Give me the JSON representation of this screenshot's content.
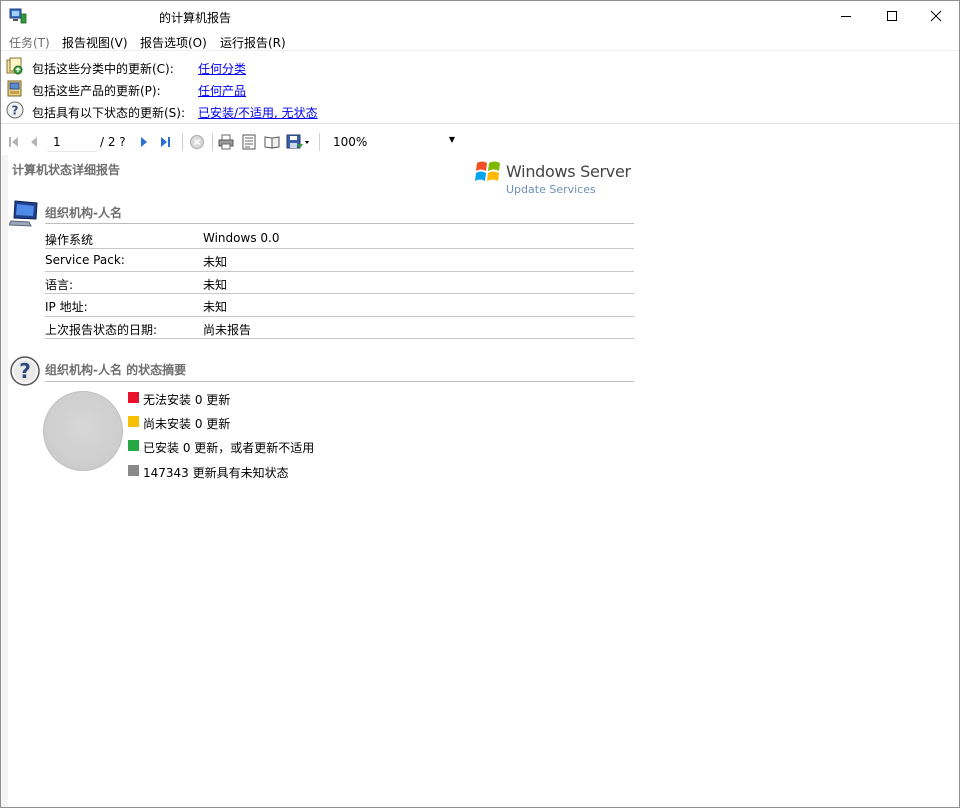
{
  "window": {
    "title": "的计算机报告"
  },
  "menu": [
    "任务(T)",
    "报告视图(V)",
    "报告选项(O)",
    "运行报告(R)"
  ],
  "criteria": [
    {
      "label": "包括这些分类中的更新(C):",
      "link": "任何分类",
      "icon": "classification-icon"
    },
    {
      "label": "包括这些产品的更新(P):",
      "link": "任何产品",
      "icon": "product-icon"
    },
    {
      "label": "包括具有以下状态的更新(S):",
      "link": "已安装/不适用, 无状态",
      "icon": "status-question-icon"
    }
  ],
  "toolbar": {
    "page_current": "1",
    "page_total": "/ 2 ?",
    "zoom": "100%"
  },
  "report": {
    "title": "计算机状态详细报告",
    "logo_name": "Windows Server",
    "logo_sub": "Update Services",
    "section1_title": "组织机构-人名",
    "info": [
      {
        "key": "操作系统",
        "value": "Windows 0.0"
      },
      {
        "key": "Service Pack:",
        "value": "未知"
      },
      {
        "key": "语言:",
        "value": "未知"
      },
      {
        "key": "IP 地址:",
        "value": "未知"
      },
      {
        "key": "上次报告状态的日期:",
        "value": "尚未报告"
      }
    ],
    "section2_title": "组织机构-人名 的状态摘要",
    "legend": [
      {
        "label": "无法安装 0 更新",
        "color": "#e8102a"
      },
      {
        "label": "尚未安装 0 更新",
        "color": "#f4c000"
      },
      {
        "label": "已安装 0 更新，或者更新不适用",
        "color": "#28a745"
      },
      {
        "label": "147343 更新具有未知状态",
        "color": "#8a8a8a"
      }
    ]
  }
}
